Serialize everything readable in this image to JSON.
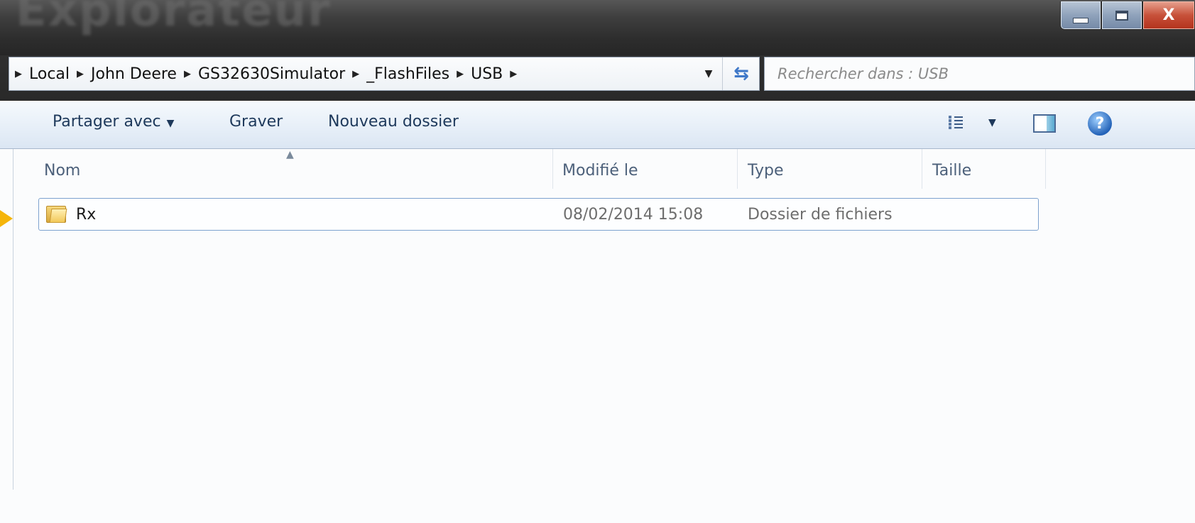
{
  "window": {
    "controls": {
      "minimize_icon": "minimize-icon",
      "maximize_icon": "maximize-icon",
      "close_label": "X"
    }
  },
  "address_bar": {
    "breadcrumbs": [
      "Local",
      "John Deere",
      "GS32630Simulator",
      "_FlashFiles",
      "USB"
    ],
    "separator": "▶",
    "dropdown_icon": "chevron-down-icon",
    "refresh_icon": "refresh-icon"
  },
  "search": {
    "placeholder": "Rechercher dans : USB"
  },
  "toolbar": {
    "share_label": "Partager avec",
    "burn_label": "Graver",
    "new_folder_label": "Nouveau dossier",
    "view_icon": "view-list-icon",
    "preview_pane_icon": "preview-pane-icon",
    "help_label": "?"
  },
  "file_list": {
    "columns": [
      "Nom",
      "Modifié le",
      "Type",
      "Taille"
    ],
    "rows": [
      {
        "name": "Rx",
        "modified": "08/02/2014 15:08",
        "type": "Dossier de fichiers",
        "size": "",
        "icon": "folder-icon"
      }
    ]
  },
  "colors": {
    "pointer": "#f5b50a",
    "toolbar_text": "#1e395b",
    "selection_border": "#7da2ce"
  }
}
